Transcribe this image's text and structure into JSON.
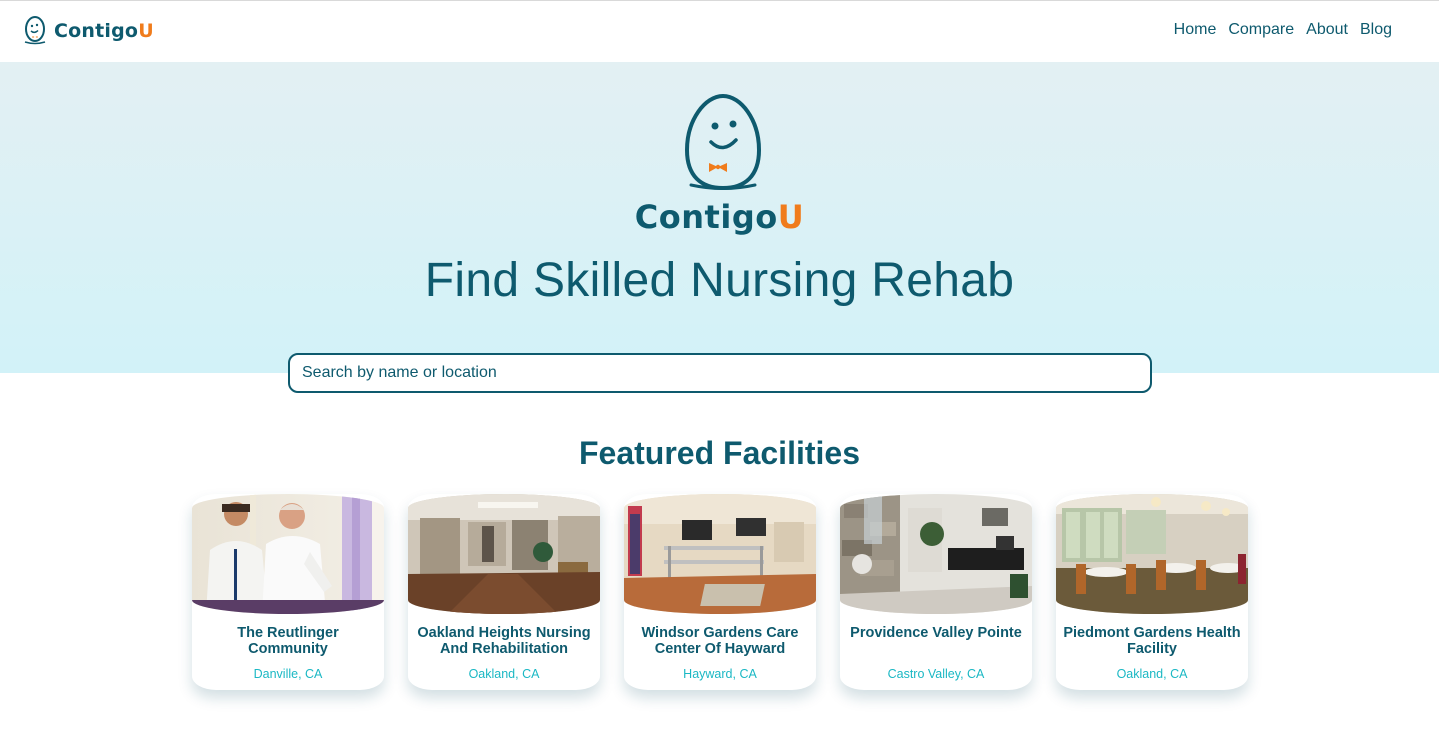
{
  "header": {
    "brand_main": "Contigo",
    "brand_accent": "U",
    "nav": [
      {
        "label": "Home"
      },
      {
        "label": "Compare"
      },
      {
        "label": "About"
      },
      {
        "label": "Blog"
      }
    ]
  },
  "hero": {
    "brand_main": "Contigo",
    "brand_accent": "U",
    "title": "Find Skilled Nursing Rehab"
  },
  "search": {
    "placeholder": "Search by name or location"
  },
  "featured": {
    "title": "Featured Facilities",
    "facilities": [
      {
        "name": "The Reutlinger Community",
        "location": "Danville, CA",
        "image": "therapy-session-photo"
      },
      {
        "name": "Oakland Heights Nursing And Rehabilitation",
        "location": "Oakland, CA",
        "image": "hallway-lounge-photo"
      },
      {
        "name": "Windsor Gardens Care Center Of Hayward",
        "location": "Hayward, CA",
        "image": "rehab-gym-photo"
      },
      {
        "name": "Providence Valley Pointe",
        "location": "Castro Valley, CA",
        "image": "lobby-stone-wall-photo"
      },
      {
        "name": "Piedmont Gardens Health Facility",
        "location": "Oakland, CA",
        "image": "dining-room-photo"
      }
    ]
  },
  "colors": {
    "primary": "#0e5a6e",
    "accent": "#f07c1c",
    "location_text": "#1bb8c4",
    "hero_bg_top": "#e3f0f3",
    "hero_bg_bottom": "#d2f2f8"
  }
}
